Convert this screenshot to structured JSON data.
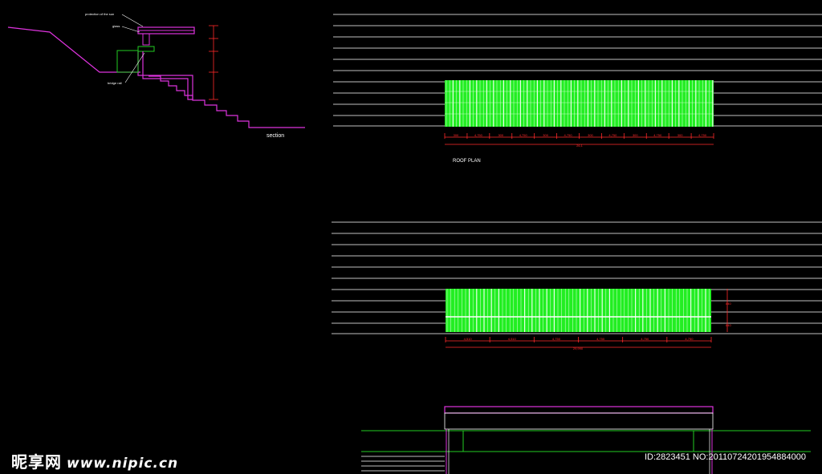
{
  "section": {
    "caption": "section",
    "callouts": [
      "protection of the sun",
      "glass",
      "bridge rail"
    ]
  },
  "roof_plan": {
    "caption": "ROOF PLAN",
    "dims": [
      "300",
      "4,750",
      "300",
      "4,750",
      "300",
      "4,750",
      "300",
      "4,750",
      "300",
      "4,750",
      "300",
      "4,750"
    ],
    "total": "26,1"
  },
  "plan2": {
    "dims": [
      "4,510",
      "4,510",
      "4,750",
      "4,750",
      "4,750",
      "4,750"
    ],
    "total": "29,990",
    "side_dims": [
      "840",
      "840"
    ]
  },
  "watermark": {
    "logo": "昵享网",
    "url": "www.nipic.cn",
    "id": "ID:2823451 NO:20110724201954884000"
  },
  "colors": {
    "background": "#000000",
    "lines": "#ffffff",
    "panels": "#22ee22",
    "dimensions": "#ff2a2a",
    "structure": "#dd33dd",
    "ground": "#22cc22"
  }
}
